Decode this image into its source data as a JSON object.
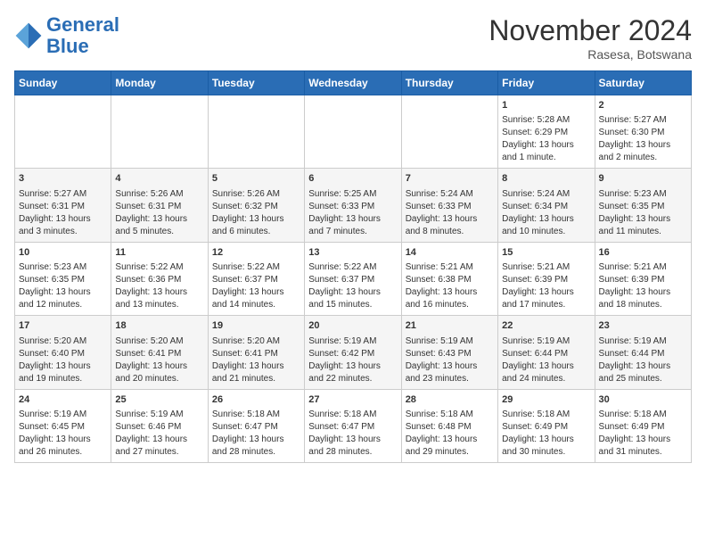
{
  "header": {
    "logo_line1": "General",
    "logo_line2": "Blue",
    "month_title": "November 2024",
    "location": "Rasesa, Botswana"
  },
  "columns": [
    "Sunday",
    "Monday",
    "Tuesday",
    "Wednesday",
    "Thursday",
    "Friday",
    "Saturday"
  ],
  "weeks": [
    [
      {
        "day": "",
        "details": ""
      },
      {
        "day": "",
        "details": ""
      },
      {
        "day": "",
        "details": ""
      },
      {
        "day": "",
        "details": ""
      },
      {
        "day": "",
        "details": ""
      },
      {
        "day": "1",
        "details": "Sunrise: 5:28 AM\nSunset: 6:29 PM\nDaylight: 13 hours\nand 1 minute."
      },
      {
        "day": "2",
        "details": "Sunrise: 5:27 AM\nSunset: 6:30 PM\nDaylight: 13 hours\nand 2 minutes."
      }
    ],
    [
      {
        "day": "3",
        "details": "Sunrise: 5:27 AM\nSunset: 6:31 PM\nDaylight: 13 hours\nand 3 minutes."
      },
      {
        "day": "4",
        "details": "Sunrise: 5:26 AM\nSunset: 6:31 PM\nDaylight: 13 hours\nand 5 minutes."
      },
      {
        "day": "5",
        "details": "Sunrise: 5:26 AM\nSunset: 6:32 PM\nDaylight: 13 hours\nand 6 minutes."
      },
      {
        "day": "6",
        "details": "Sunrise: 5:25 AM\nSunset: 6:33 PM\nDaylight: 13 hours\nand 7 minutes."
      },
      {
        "day": "7",
        "details": "Sunrise: 5:24 AM\nSunset: 6:33 PM\nDaylight: 13 hours\nand 8 minutes."
      },
      {
        "day": "8",
        "details": "Sunrise: 5:24 AM\nSunset: 6:34 PM\nDaylight: 13 hours\nand 10 minutes."
      },
      {
        "day": "9",
        "details": "Sunrise: 5:23 AM\nSunset: 6:35 PM\nDaylight: 13 hours\nand 11 minutes."
      }
    ],
    [
      {
        "day": "10",
        "details": "Sunrise: 5:23 AM\nSunset: 6:35 PM\nDaylight: 13 hours\nand 12 minutes."
      },
      {
        "day": "11",
        "details": "Sunrise: 5:22 AM\nSunset: 6:36 PM\nDaylight: 13 hours\nand 13 minutes."
      },
      {
        "day": "12",
        "details": "Sunrise: 5:22 AM\nSunset: 6:37 PM\nDaylight: 13 hours\nand 14 minutes."
      },
      {
        "day": "13",
        "details": "Sunrise: 5:22 AM\nSunset: 6:37 PM\nDaylight: 13 hours\nand 15 minutes."
      },
      {
        "day": "14",
        "details": "Sunrise: 5:21 AM\nSunset: 6:38 PM\nDaylight: 13 hours\nand 16 minutes."
      },
      {
        "day": "15",
        "details": "Sunrise: 5:21 AM\nSunset: 6:39 PM\nDaylight: 13 hours\nand 17 minutes."
      },
      {
        "day": "16",
        "details": "Sunrise: 5:21 AM\nSunset: 6:39 PM\nDaylight: 13 hours\nand 18 minutes."
      }
    ],
    [
      {
        "day": "17",
        "details": "Sunrise: 5:20 AM\nSunset: 6:40 PM\nDaylight: 13 hours\nand 19 minutes."
      },
      {
        "day": "18",
        "details": "Sunrise: 5:20 AM\nSunset: 6:41 PM\nDaylight: 13 hours\nand 20 minutes."
      },
      {
        "day": "19",
        "details": "Sunrise: 5:20 AM\nSunset: 6:41 PM\nDaylight: 13 hours\nand 21 minutes."
      },
      {
        "day": "20",
        "details": "Sunrise: 5:19 AM\nSunset: 6:42 PM\nDaylight: 13 hours\nand 22 minutes."
      },
      {
        "day": "21",
        "details": "Sunrise: 5:19 AM\nSunset: 6:43 PM\nDaylight: 13 hours\nand 23 minutes."
      },
      {
        "day": "22",
        "details": "Sunrise: 5:19 AM\nSunset: 6:44 PM\nDaylight: 13 hours\nand 24 minutes."
      },
      {
        "day": "23",
        "details": "Sunrise: 5:19 AM\nSunset: 6:44 PM\nDaylight: 13 hours\nand 25 minutes."
      }
    ],
    [
      {
        "day": "24",
        "details": "Sunrise: 5:19 AM\nSunset: 6:45 PM\nDaylight: 13 hours\nand 26 minutes."
      },
      {
        "day": "25",
        "details": "Sunrise: 5:19 AM\nSunset: 6:46 PM\nDaylight: 13 hours\nand 27 minutes."
      },
      {
        "day": "26",
        "details": "Sunrise: 5:18 AM\nSunset: 6:47 PM\nDaylight: 13 hours\nand 28 minutes."
      },
      {
        "day": "27",
        "details": "Sunrise: 5:18 AM\nSunset: 6:47 PM\nDaylight: 13 hours\nand 28 minutes."
      },
      {
        "day": "28",
        "details": "Sunrise: 5:18 AM\nSunset: 6:48 PM\nDaylight: 13 hours\nand 29 minutes."
      },
      {
        "day": "29",
        "details": "Sunrise: 5:18 AM\nSunset: 6:49 PM\nDaylight: 13 hours\nand 30 minutes."
      },
      {
        "day": "30",
        "details": "Sunrise: 5:18 AM\nSunset: 6:49 PM\nDaylight: 13 hours\nand 31 minutes."
      }
    ]
  ]
}
